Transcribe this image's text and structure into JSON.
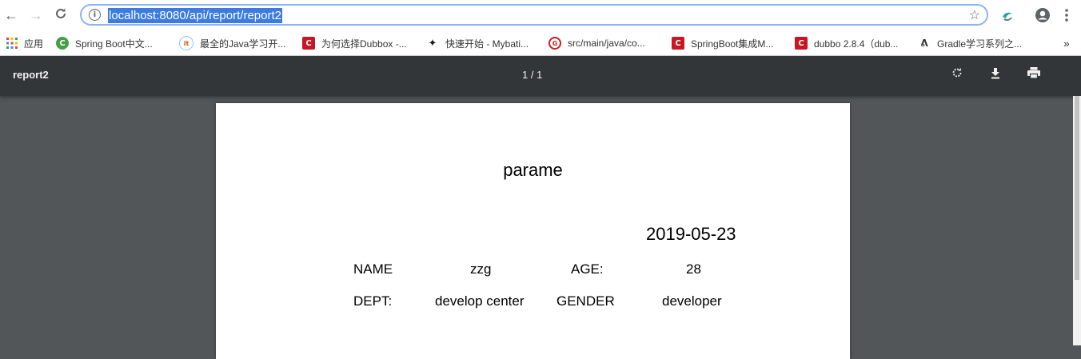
{
  "browser": {
    "url": "localhost:8080/api/report/report2",
    "bookmarks": [
      {
        "label": "应用",
        "icon": "apps-grid-icon"
      },
      {
        "label": "Spring Boot中文...",
        "icon": "spring-icon",
        "color": "#43a047"
      },
      {
        "label": "最全的Java学习开...",
        "icon": "iteye-icon",
        "color": "#e65100"
      },
      {
        "label": "为何选择Dubbox -...",
        "icon": "csdn-icon",
        "color": "#c81623"
      },
      {
        "label": "快速开始 - Mybati...",
        "icon": "bird-icon",
        "color": "#1b1b1b"
      },
      {
        "label": "src/main/java/co...",
        "icon": "gitee-icon",
        "color": "#c71d23"
      },
      {
        "label": "SpringBoot集成M...",
        "icon": "csdn-icon",
        "color": "#c81623"
      },
      {
        "label": "dubbo 2.8.4（dub...",
        "icon": "csdn-icon",
        "color": "#c81623"
      },
      {
        "label": "Gradle学习系列之...",
        "icon": "gradle-icon",
        "color": "#333333"
      }
    ],
    "more_bookmarks": "»"
  },
  "pdf_viewer": {
    "title": "report2",
    "page_indicator": "1 / 1"
  },
  "report": {
    "title": "parame",
    "date": "2019-05-23",
    "name_label": "NAME",
    "name_value": "zzg",
    "age_label": "AGE:",
    "age_value": "28",
    "dept_label": "DEPT:",
    "dept_value": "develop center",
    "gender_label": "GENDER",
    "gender_value": "developer"
  }
}
